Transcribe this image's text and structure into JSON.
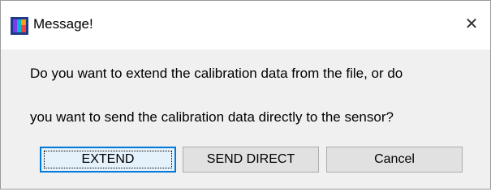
{
  "window": {
    "title": "Message!",
    "close_glyph": "✕"
  },
  "message": {
    "line1": "Do you want to extend the calibration data from the file, or do",
    "line2": "you want to send the calibration data directly to the sensor?"
  },
  "buttons": {
    "extend_label": "EXTEND",
    "send_direct_label": "SEND DIRECT",
    "cancel_label": "Cancel"
  },
  "icons": {
    "app": "app-icon",
    "close": "close-icon"
  },
  "colors": {
    "accent": "#0078d7",
    "default_button_bg": "#e5f1fb",
    "button_bg": "#e1e1e1",
    "dialog_bg": "#f0f0f0"
  }
}
